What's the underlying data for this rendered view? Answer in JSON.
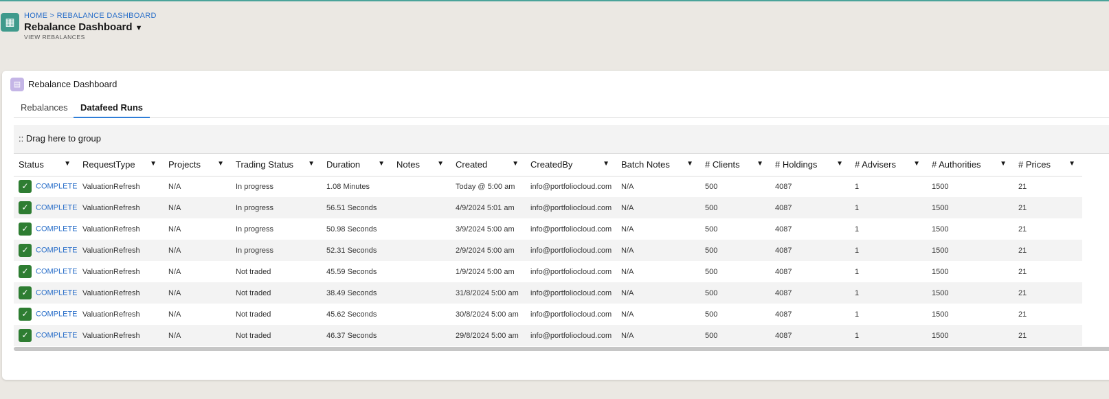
{
  "header": {
    "breadcrumb": "HOME > REBALANCE DASHBOARD",
    "title": "Rebalance Dashboard",
    "subtitle": "VIEW REBALANCES"
  },
  "card": {
    "title": "Rebalance Dashboard",
    "tabs": [
      {
        "label": "Rebalances"
      },
      {
        "label": "Datafeed Runs",
        "active": true
      }
    ],
    "group_hint": ":: Drag here to group"
  },
  "table": {
    "columns": [
      "Status",
      "RequestType",
      "Projects",
      "Trading Status",
      "Duration",
      "Notes",
      "Created",
      "CreatedBy",
      "Batch Notes",
      "# Clients",
      "# Holdings",
      "# Advisers",
      "# Authorities",
      "# Prices"
    ],
    "rows": [
      [
        "COMPLETE",
        "ValuationRefresh",
        "N/A",
        "In progress",
        "1.08 Minutes",
        "",
        "Today @ 5:00 am",
        "info@portfoliocloud.com",
        "N/A",
        "500",
        "4087",
        "1",
        "1500",
        "21"
      ],
      [
        "COMPLETE",
        "ValuationRefresh",
        "N/A",
        "In progress",
        "56.51 Seconds",
        "",
        "4/9/2024 5:01 am",
        "info@portfoliocloud.com",
        "N/A",
        "500",
        "4087",
        "1",
        "1500",
        "21"
      ],
      [
        "COMPLETE",
        "ValuationRefresh",
        "N/A",
        "In progress",
        "50.98 Seconds",
        "",
        "3/9/2024 5:00 am",
        "info@portfoliocloud.com",
        "N/A",
        "500",
        "4087",
        "1",
        "1500",
        "21"
      ],
      [
        "COMPLETE",
        "ValuationRefresh",
        "N/A",
        "In progress",
        "52.31 Seconds",
        "",
        "2/9/2024 5:00 am",
        "info@portfoliocloud.com",
        "N/A",
        "500",
        "4087",
        "1",
        "1500",
        "21"
      ],
      [
        "COMPLETE",
        "ValuationRefresh",
        "N/A",
        "Not traded",
        "45.59 Seconds",
        "",
        "1/9/2024 5:00 am",
        "info@portfoliocloud.com",
        "N/A",
        "500",
        "4087",
        "1",
        "1500",
        "21"
      ],
      [
        "COMPLETE",
        "ValuationRefresh",
        "N/A",
        "Not traded",
        "38.49 Seconds",
        "",
        "31/8/2024 5:00 am",
        "info@portfoliocloud.com",
        "N/A",
        "500",
        "4087",
        "1",
        "1500",
        "21"
      ],
      [
        "COMPLETE",
        "ValuationRefresh",
        "N/A",
        "Not traded",
        "45.62 Seconds",
        "",
        "30/8/2024 5:00 am",
        "info@portfoliocloud.com",
        "N/A",
        "500",
        "4087",
        "1",
        "1500",
        "21"
      ],
      [
        "COMPLETE",
        "ValuationRefresh",
        "N/A",
        "Not traded",
        "46.37 Seconds",
        "",
        "29/8/2024 5:00 am",
        "info@portfoliocloud.com",
        "N/A",
        "500",
        "4087",
        "1",
        "1500",
        "21"
      ]
    ]
  }
}
